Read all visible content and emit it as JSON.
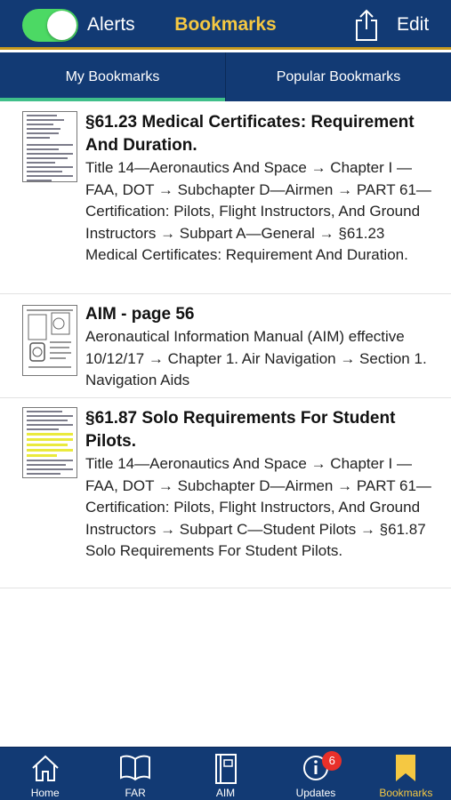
{
  "header": {
    "alerts_label": "Alerts",
    "alerts_on": true,
    "title": "Bookmarks",
    "edit_label": "Edit",
    "share_icon": "share-icon"
  },
  "tabs": [
    {
      "label": "My Bookmarks",
      "active": true
    },
    {
      "label": "Popular Bookmarks",
      "active": false
    }
  ],
  "bookmarks": [
    {
      "title": "§61.23   Medical Certificates: Requirement And Duration.",
      "path": "Title 14—Aeronautics And Space → Chapter I —FAA, DOT → Subchapter D—Airmen → PART 61—Certification: Pilots, Flight Instructors, And Ground Instructors → Subpart A—General → §61.23   Medical Certificates: Requirement And Duration."
    },
    {
      "title": "AIM - page 56",
      "path": "Aeronautical Information Manual (AIM) effective 10/12/17 → Chapter 1. Air Navigation → Section 1. Navigation Aids"
    },
    {
      "title": "§61.87   Solo Requirements For Student Pilots.",
      "path": "Title 14—Aeronautics And Space → Chapter I —FAA, DOT → Subchapter D—Airmen → PART 61—Certification: Pilots, Flight Instructors, And Ground Instructors → Subpart C—Student Pilots → §61.87   Solo Requirements For Student Pilots."
    }
  ],
  "bottom_tabs": [
    {
      "label": "Home",
      "icon": "home-icon"
    },
    {
      "label": "FAR",
      "icon": "book-icon"
    },
    {
      "label": "AIM",
      "icon": "manual-icon"
    },
    {
      "label": "Updates",
      "icon": "info-icon",
      "badge": "6"
    },
    {
      "label": "Bookmarks",
      "icon": "bookmark-icon",
      "active": true
    }
  ],
  "colors": {
    "bar": "#123a74",
    "accent_gold": "#f5c842",
    "tab_indicator": "#3fbf8a",
    "toggle_on": "#4cd964",
    "badge": "#e8302a"
  }
}
